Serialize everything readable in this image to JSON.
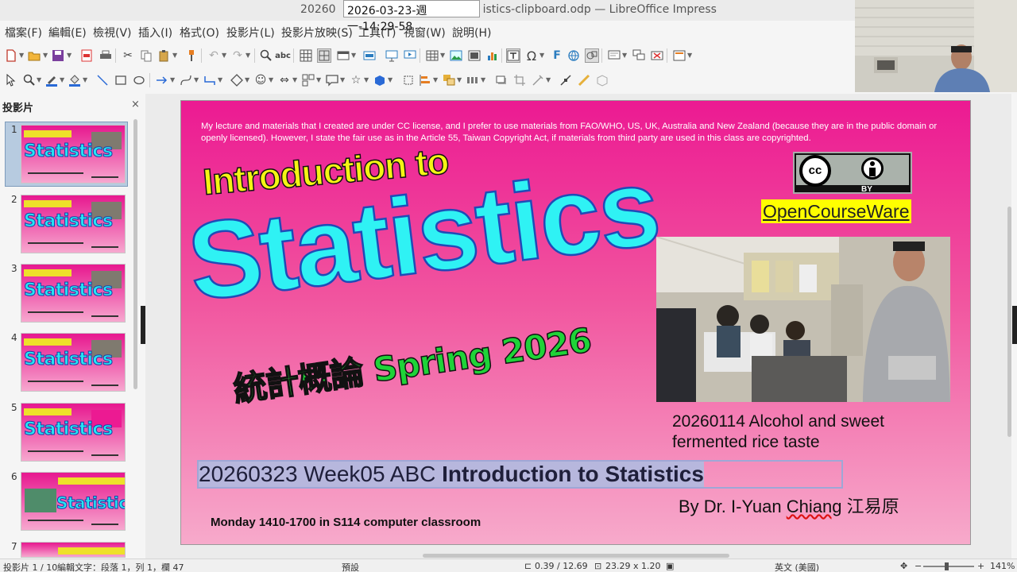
{
  "window": {
    "title_left": "20260",
    "title_right": "istics-clipboard.odp — LibreOffice Impress",
    "overlay_timestamp": "2026-03-23-週一-14:29-58"
  },
  "menu": [
    "檔案(F)",
    "編輯(E)",
    "檢視(V)",
    "插入(I)",
    "格式(O)",
    "投影片(L)",
    "投影片放映(S)",
    "工具(T)",
    "視窗(W)",
    "說明(H)"
  ],
  "toolbar1": [
    "new-icon",
    "open-icon",
    "save-icon",
    "export-pdf-icon",
    "print-icon",
    "cut-icon",
    "copy-icon",
    "paste-icon",
    "clone-format-icon",
    "undo-icon",
    "redo-icon",
    "find-replace-icon",
    "spelling-icon",
    "grid-icon",
    "slide-icon",
    "master-slide-icon",
    "display-views-icon",
    "table-icon",
    "image-icon",
    "media-icon",
    "chart-icon",
    "textbox-icon",
    "special-char-icon",
    "fontwork-icon",
    "hyperlink-icon",
    "draw-functions-icon"
  ],
  "toolbar2": [
    "select-icon",
    "zoom-icon",
    "line-color-icon",
    "fill-color-icon",
    "line-icon",
    "rectangle-icon",
    "ellipse-icon",
    "arrow-icon",
    "curve-icon",
    "connector-icon",
    "basic-shapes-icon",
    "symbol-shapes-icon",
    "block-arrows-icon",
    "flowchart-icon",
    "callouts-icon",
    "stars-icon",
    "3d-objects-icon",
    "rotate-icon",
    "align-icon",
    "arrange-icon",
    "distribute-icon",
    "shadow-icon",
    "crop-icon",
    "filter-icon",
    "points-icon",
    "gluepoints-icon",
    "toggle-extrusion-icon"
  ],
  "panel": {
    "title": "投影片",
    "close": "×",
    "slide_numbers": [
      "1",
      "2",
      "3",
      "4",
      "5",
      "6",
      "7"
    ],
    "thumb_label": "Statistics"
  },
  "slide": {
    "notice": "My lecture and materials that I created are under CC license, and I prefer to use materials from FAO/WHO, US, UK, Australia and New Zealand (because they are in the public domain or openly licensed). However, I  state the fair use as in the Article 55, Taiwan Copyright Act, if materials from third party are used in this class are copyrighted.",
    "cc_label": "cc",
    "cc_by": "BY",
    "ocw": "OpenCourseWare",
    "intro": "Introduction to",
    "statistics": "Statistics",
    "spring": "統計概論 Spring 2026",
    "caption_line1": "20260114 Alcohol and sweet",
    "caption_line2": "fermented rice taste",
    "week_prefix": "20260323 Week05 ABC ",
    "week_bold": "Introduction to Statistics",
    "author_prefix": "By Dr. I-Yuan ",
    "author_chiang": "Chiang",
    "author_suffix": " 江易原",
    "monday": "Monday 1410-1700 in S114   computer classroom"
  },
  "status": {
    "slide_count": "投影片 1 / 10",
    "edit_text": "編輯文字：段落 1，列 1，欄 47",
    "layout": "預設",
    "position": "0.39 / 12.69",
    "size": "23.29 x 1.20",
    "language": "英文 (美國)",
    "zoom_minus": "−",
    "zoom_plus": "+",
    "zoom": "141%"
  }
}
